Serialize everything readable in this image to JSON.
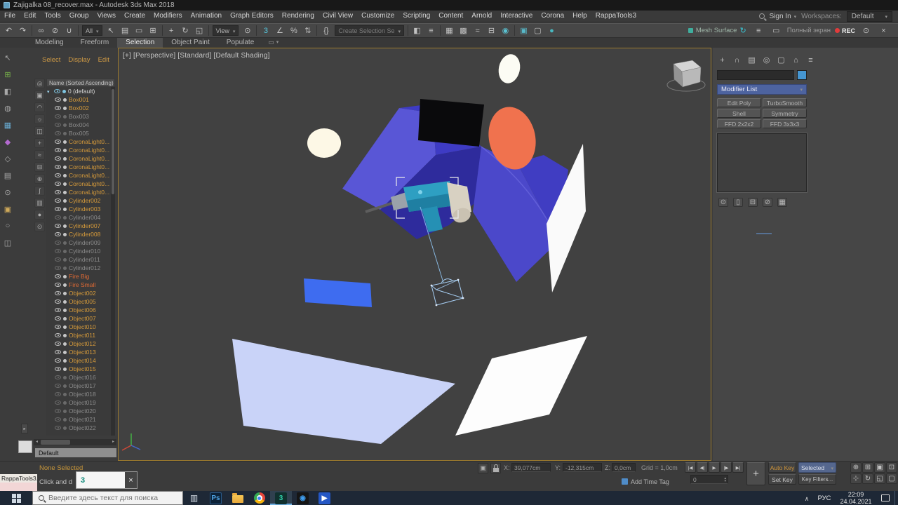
{
  "titlebar": {
    "title": "Zajigalka 08_recover.max - Autodesk 3ds Max 2018"
  },
  "menubar": {
    "items": [
      "File",
      "Edit",
      "Tools",
      "Group",
      "Views",
      "Create",
      "Modifiers",
      "Animation",
      "Graph Editors",
      "Rendering",
      "Civil View",
      "Customize",
      "Scripting",
      "Content",
      "Arnold",
      "Interactive",
      "Corona",
      "Help",
      "RappaTools3"
    ],
    "sign_in": "Sign In",
    "workspaces_label": "Workspaces:",
    "workspace_value": "Default"
  },
  "toolbar": {
    "items": [
      [
        "i",
        "undo-icon",
        "↶"
      ],
      [
        "i",
        "redo-icon",
        "↷"
      ],
      [
        "s"
      ],
      [
        "i",
        "select-and-link-icon",
        "∞"
      ],
      [
        "i",
        "unlink-selection-icon",
        "⊘"
      ],
      [
        "i",
        "bind-to-spacewarp-icon",
        "∪"
      ],
      [
        "s"
      ],
      [
        "d",
        "selection-filter-dropdown",
        "All"
      ],
      [
        "i",
        "select-object-icon",
        "↖"
      ],
      [
        "i",
        "select-by-name-icon",
        "▤"
      ],
      [
        "i",
        "selection-region-icon",
        "▭"
      ],
      [
        "i",
        "window-crossing-icon",
        "⊞"
      ],
      [
        "s"
      ],
      [
        "i",
        "select-and-move-icon",
        "+"
      ],
      [
        "i",
        "select-and-rotate-icon",
        "↻"
      ],
      [
        "i",
        "select-and-scale-icon",
        "◱"
      ],
      [
        "s"
      ],
      [
        "d",
        "reference-coordinate-dropdown",
        "View"
      ],
      [
        "i",
        "use-pivot-center-icon",
        "⊙"
      ],
      [
        "s"
      ],
      [
        "i",
        "snaps-toggle-icon",
        "3",
        "#56c8e0"
      ],
      [
        "i",
        "angle-snap-icon",
        "∠"
      ],
      [
        "i",
        "percent-snap-icon",
        "%"
      ],
      [
        "i",
        "spinner-snap-icon",
        "⇅"
      ],
      [
        "s"
      ],
      [
        "i",
        "named-selection-sets-icon",
        "{}"
      ],
      [
        "d",
        "create-selection-set-dropdown",
        "Create Selection Se",
        "muted"
      ],
      [
        "s"
      ],
      [
        "i",
        "mirror-icon",
        "◧"
      ],
      [
        "i",
        "align-icon",
        "≡"
      ],
      [
        "s"
      ],
      [
        "i",
        "layer-manager-icon",
        "▦"
      ],
      [
        "i",
        "ribbon-toggle-icon",
        "▩"
      ],
      [
        "i",
        "curve-editor-icon",
        "≈"
      ],
      [
        "i",
        "schematic-view-icon",
        "⊟"
      ],
      [
        "i",
        "material-editor-icon",
        "◉",
        "#5ac0d0"
      ],
      [
        "s"
      ],
      [
        "i",
        "render-setup-icon",
        "▣",
        "#58b8c8"
      ],
      [
        "i",
        "render-frame-window-icon",
        "▢"
      ],
      [
        "i",
        "render-production-icon",
        "●",
        "#49b8c0"
      ]
    ],
    "mesh_surface_label": "Mesh Surface",
    "recorder": {
      "fullscreen": "Полный экран",
      "rec": "REC"
    }
  },
  "ribbon": {
    "tabs": [
      "Modeling",
      "Freeform",
      "Selection",
      "Object Paint",
      "Populate"
    ],
    "active": "Selection"
  },
  "left_dock_icons": [
    [
      "dock-tool-icon-1",
      "↖"
    ],
    [
      "dock-tool-icon-2",
      "⊞",
      "#79b54a"
    ],
    [
      "dock-tool-icon-3",
      "◧"
    ],
    [
      "dock-tool-icon-4",
      "◍"
    ],
    [
      "dock-tool-icon-5",
      "▦",
      "#6ab0d8"
    ],
    [
      "dock-tool-icon-6",
      "◆",
      "#b46ad0"
    ],
    [
      "dock-tool-icon-7",
      "◇"
    ],
    [
      "dock-tool-icon-8",
      "▤"
    ],
    [
      "dock-tool-icon-9",
      "⊙"
    ],
    [
      "dock-tool-icon-10",
      "▣",
      "#d0aa5a"
    ],
    [
      "dock-tool-icon-11",
      "○"
    ],
    [
      "dock-tool-icon-12",
      "◫"
    ]
  ],
  "scene_explorer": {
    "menu": [
      "Select",
      "Display",
      "Edit"
    ],
    "column_header": "Name (Sorted Ascending)",
    "root_label": "0 (default)",
    "layer_label": "Default",
    "filter_icons": [
      [
        "filter-all-icon",
        "◎"
      ],
      [
        "filter-geometry-icon",
        "▣"
      ],
      [
        "filter-shapes-icon",
        "◠"
      ],
      [
        "filter-lights-icon",
        "☼"
      ],
      [
        "filter-cameras-icon",
        "◫"
      ],
      [
        "filter-helpers-icon",
        "+"
      ],
      [
        "filter-spacewarps-icon",
        "≈"
      ],
      [
        "filter-groups-icon",
        "⊟"
      ],
      [
        "filter-xrefs-icon",
        "⊕"
      ],
      [
        "filter-bones-icon",
        "∫"
      ],
      [
        "filter-containers-icon",
        "▥"
      ],
      [
        "filter-materials-icon",
        "●"
      ],
      [
        "filter-find-icon",
        "⊙"
      ]
    ],
    "items": [
      [
        "Box001",
        "on"
      ],
      [
        "Box002",
        "on"
      ],
      [
        "Box003",
        "off"
      ],
      [
        "Box004",
        "off"
      ],
      [
        "Box005",
        "off"
      ],
      [
        "CoronaLight0...",
        "on"
      ],
      [
        "CoronaLight0...",
        "on"
      ],
      [
        "CoronaLight0...",
        "on"
      ],
      [
        "CoronaLight0...",
        "on"
      ],
      [
        "CoronaLight0...",
        "on"
      ],
      [
        "CoronaLight0...",
        "on"
      ],
      [
        "CoronaLight0...",
        "on"
      ],
      [
        "Cylinder002",
        "on"
      ],
      [
        "Cylinder003",
        "on"
      ],
      [
        "Cylinder004",
        "off"
      ],
      [
        "Cylinder007",
        "on"
      ],
      [
        "Cylinder008",
        "on"
      ],
      [
        "Cylinder009",
        "off"
      ],
      [
        "Cylinder010",
        "off"
      ],
      [
        "Cylinder011",
        "off"
      ],
      [
        "Cylinder012",
        "off"
      ],
      [
        "Fire Big",
        "fire"
      ],
      [
        "Fire Small",
        "fire"
      ],
      [
        "Object002",
        "on"
      ],
      [
        "Object005",
        "on"
      ],
      [
        "Object006",
        "on"
      ],
      [
        "Object007",
        "on"
      ],
      [
        "Object010",
        "on"
      ],
      [
        "Object011",
        "on"
      ],
      [
        "Object012",
        "on"
      ],
      [
        "Object013",
        "on"
      ],
      [
        "Object014",
        "on"
      ],
      [
        "Object015",
        "on"
      ],
      [
        "Object016",
        "off"
      ],
      [
        "Object017",
        "off"
      ],
      [
        "Object018",
        "off"
      ],
      [
        "Object019",
        "off"
      ],
      [
        "Object020",
        "off"
      ],
      [
        "Object021",
        "off"
      ],
      [
        "Object022",
        "off"
      ]
    ]
  },
  "viewport": {
    "label": "[+] [Perspective] [Standard] [Default Shading]"
  },
  "command_panel": {
    "tabs": [
      [
        "create-tab-icon",
        "+"
      ],
      [
        "modify-tab-icon",
        "∩"
      ],
      [
        "hierarchy-tab-icon",
        "▤"
      ],
      [
        "motion-tab-icon",
        "◎"
      ],
      [
        "display-tab-icon",
        "▢"
      ],
      [
        "utilities-tab-icon",
        "⌂"
      ],
      [
        "configure-rollouts-icon",
        "≡"
      ]
    ],
    "modifier_list_label": "Modifier List",
    "preset_buttons": [
      "Edit Poly",
      "TurboSmooth",
      "Shell",
      "Symmetry",
      "FFD 2x2x2",
      "FFD 3x3x3"
    ],
    "stack_icons": [
      [
        "pin-stack-icon",
        "⊙"
      ],
      [
        "show-end-result-icon",
        "▯"
      ],
      [
        "make-unique-icon",
        "⊟"
      ],
      [
        "remove-modifier-icon",
        "⊘"
      ],
      [
        "configure-modifier-sets-icon",
        "▦"
      ]
    ]
  },
  "status": {
    "selection_text": "None Selected",
    "prompt_text": "Click and d",
    "mini_listener_text": "RappaTools3.",
    "coords": {
      "x_label": "X:",
      "x": "39,077cm",
      "y_label": "Y:",
      "y": "-12,315cm",
      "z_label": "Z:",
      "z": "0,0cm"
    },
    "grid_text": "Grid = 1,0cm",
    "add_time_tag": "Add Time Tag",
    "frame": "0",
    "auto_key": "Auto Key",
    "selected_dropdown": "Selected",
    "set_key": "Set Key",
    "key_filters": "Key Filters...",
    "playback": [
      [
        "go-to-start-button",
        "|◀"
      ],
      [
        "previous-frame-button",
        "◀|"
      ],
      [
        "play-button",
        "▶"
      ],
      [
        "next-frame-button",
        "|▶"
      ],
      [
        "go-to-end-button",
        "▶|"
      ]
    ],
    "nav": [
      [
        "zoom-icon",
        "⊕"
      ],
      [
        "zoom-all-icon",
        "⊞"
      ],
      [
        "zoom-extents-icon",
        "▣"
      ],
      [
        "zoom-extents-all-icon",
        "⊡"
      ],
      [
        "pan-icon",
        "⊹"
      ],
      [
        "orbit-icon",
        "↻"
      ],
      [
        "zoom-region-icon",
        "◱"
      ],
      [
        "maximize-viewport-toggle-icon",
        "▢"
      ]
    ]
  },
  "popup": {
    "app_glyph": "3"
  },
  "taskbar": {
    "search_placeholder": "Введите здесь текст для поиска",
    "lang": "РУС",
    "time": "22:09",
    "date": "24.04.2021",
    "icons": [
      {
        "n": "taskview-icon",
        "g": "▥",
        "fg": "#d6dee8",
        "plain": true
      },
      {
        "n": "photoshop-icon",
        "g": "Ps",
        "bg": "#0c2238",
        "fg": "#4fa3e3",
        "bd": "#2a5a8a"
      },
      {
        "n": "file-explorer-icon",
        "shape": "folder"
      },
      {
        "n": "chrome-icon",
        "shape": "chrome"
      },
      {
        "n": "3dsmax-icon",
        "g": "3",
        "bg": "#10302e",
        "fg": "#2fd0a8",
        "active": true
      },
      {
        "n": "media-player-icon",
        "g": "◉",
        "bg": "#151515",
        "fg": "#3f9ef0"
      },
      {
        "n": "movies-tv-icon",
        "g": "▶",
        "bg": "#2457c5",
        "fg": "#ffffff"
      }
    ]
  }
}
